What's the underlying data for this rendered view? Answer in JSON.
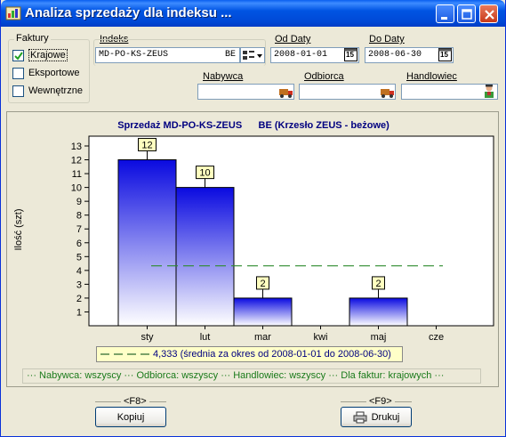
{
  "window": {
    "title": "Analiza sprzedaży dla indeksu ..."
  },
  "faktury": {
    "label": "Faktury",
    "options": [
      {
        "label": "Krajowe",
        "checked": true
      },
      {
        "label": "Eksportowe",
        "checked": false
      },
      {
        "label": "Wewnętrzne",
        "checked": false
      }
    ]
  },
  "indeks": {
    "label": "Indeks",
    "value": "MD-PO-KS-ZEUS",
    "suffix": "BE"
  },
  "od_daty": {
    "label": "Od Daty",
    "value": "2008-01-01"
  },
  "do_daty": {
    "label": "Do Daty",
    "value": "2008-06-30"
  },
  "nabywca": {
    "label": "Nabywca",
    "value": ""
  },
  "odbiorca": {
    "label": "Odbiorca",
    "value": ""
  },
  "handlowiec": {
    "label": "Handlowiec",
    "value": ""
  },
  "calendar_icon_text": "15",
  "chart_data": {
    "type": "bar",
    "title": "Sprzedaż MD-PO-KS-ZEUS      BE (Krzesło ZEUS - beżowe)",
    "ylabel": "Ilość (szt)",
    "categories": [
      "sty",
      "lut",
      "mar",
      "kwi",
      "maj",
      "cze"
    ],
    "values": [
      12,
      10,
      2,
      0,
      2,
      0
    ],
    "value_labels": [
      "12",
      "10",
      "2",
      "",
      "2",
      ""
    ],
    "yticks": [
      "1",
      "2",
      "3",
      "4",
      "5",
      "6",
      "7",
      "8",
      "9",
      "10",
      "11",
      "12",
      "13"
    ],
    "ylim": [
      0,
      13
    ],
    "average": 4.333,
    "average_legend": "4,333   (średnia za okres od 2008-01-01 do 2008-06-30)",
    "bar_color_top": "#0A0AE0",
    "bar_color_bottom": "#FFFFFF",
    "average_color": "#2E8B2E"
  },
  "filter_summary": "··· Nabywca: wszyscy  ··· Odbiorca: wszyscy  ··· Handlowiec: wszyscy  ··· Dla faktur: krajowych  ···",
  "buttons": {
    "kopiuj": {
      "hotkey": "<F8>",
      "label": "Kopiuj"
    },
    "drukuj": {
      "hotkey": "<F9>",
      "label": "Drukuj"
    }
  }
}
